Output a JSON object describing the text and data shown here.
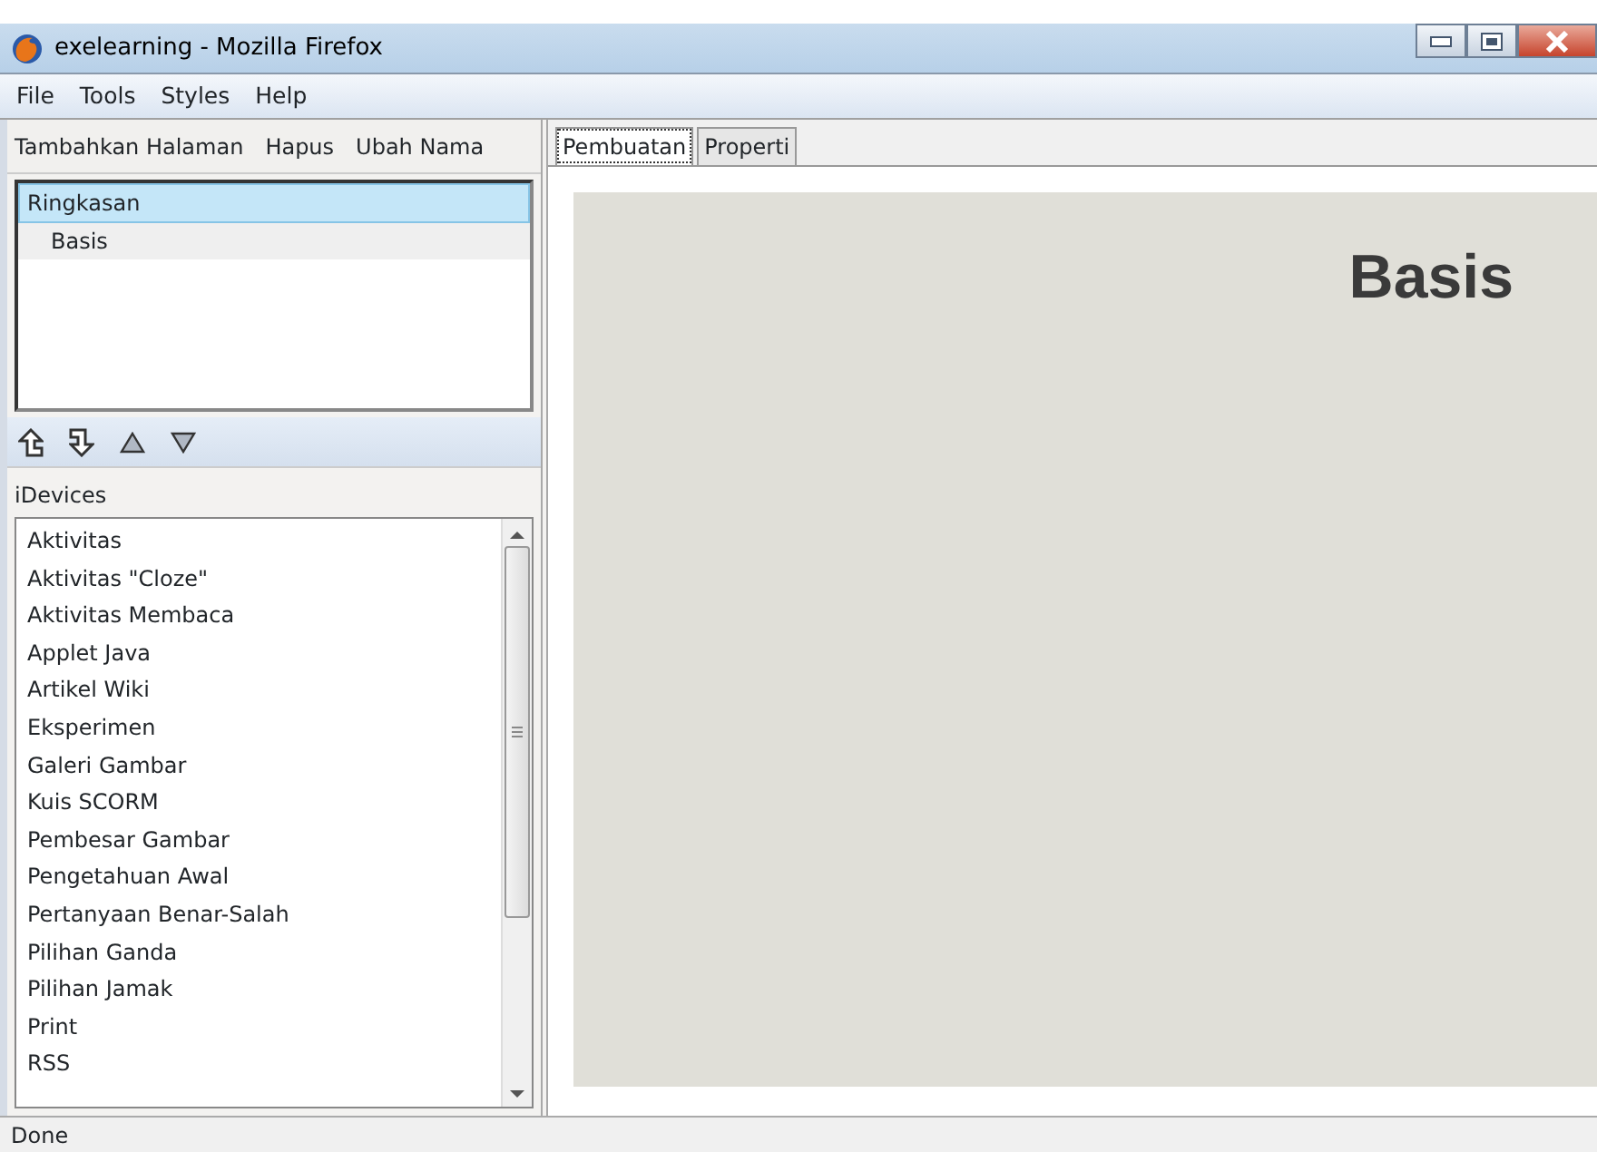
{
  "window": {
    "title": "exelearning - Mozilla Firefox"
  },
  "menu": [
    "File",
    "Tools",
    "Styles",
    "Help"
  ],
  "outline_toolbar": [
    "Tambahkan Halaman",
    "Hapus",
    "Ubah Nama"
  ],
  "outline": [
    {
      "label": "Ringkasan",
      "selected": true,
      "children": [
        {
          "label": "Basis",
          "selected": false,
          "highlighted": true
        }
      ]
    }
  ],
  "idevices": {
    "label": "iDevices",
    "items": [
      "Aktivitas",
      "Aktivitas \"Cloze\"",
      "Aktivitas Membaca",
      "Applet Java",
      "Artikel Wiki",
      "Eksperimen",
      "Galeri Gambar",
      "Kuis SCORM",
      "Pembesar Gambar",
      "Pengetahuan Awal",
      "Pertanyaan Benar-Salah",
      "Pilihan Ganda",
      "Pilihan Jamak",
      "Print",
      "RSS"
    ]
  },
  "tabs": [
    {
      "label": "Pembuatan",
      "selected": true
    },
    {
      "label": "Properti",
      "selected": false
    }
  ],
  "page": {
    "title": "Basis"
  },
  "status_bar": "Done"
}
